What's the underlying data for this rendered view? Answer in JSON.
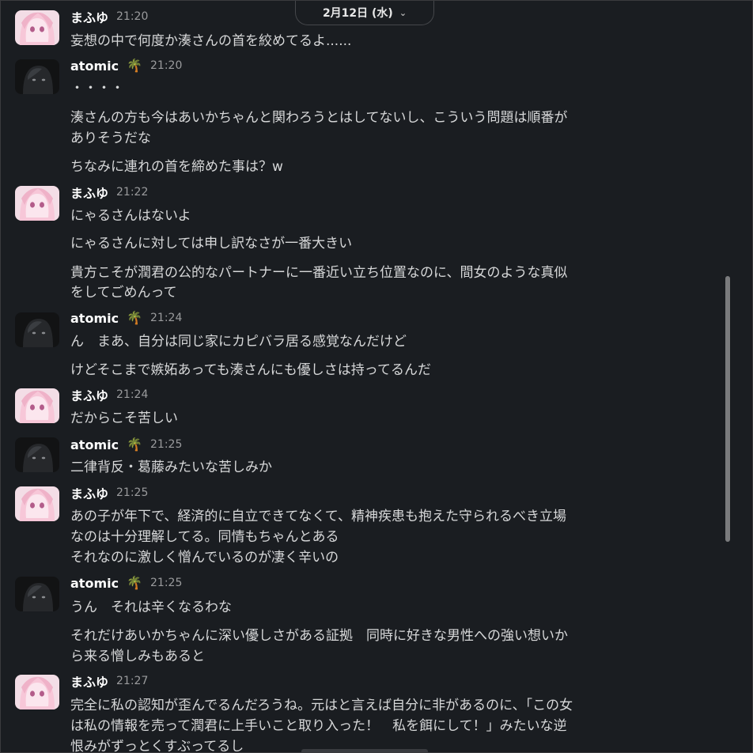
{
  "date_divider": {
    "label": "2月12日 (水)",
    "chevron_icon": "chevron-down-icon"
  },
  "users": {
    "mafuyu": {
      "name": "まふゆ",
      "avatar": "pink-anime-avatar"
    },
    "atomic": {
      "name": "atomic",
      "emoji": "🌴",
      "avatar": "dark-anime-avatar"
    }
  },
  "messages": [
    {
      "author": "まふゆ",
      "time": "21:20",
      "lines": [
        "妄想の中で何度か湊さんの首を絞めてるよ......"
      ]
    },
    {
      "author": "atomic",
      "emoji": "🌴",
      "time": "21:20",
      "lines": [
        "・・・・",
        "湊さんの方も今はあいかちゃんと関わろうとはしてないし、こういう問題は順番が",
        "ありそうだな",
        "ちなみに連れの首を締めた事は？w"
      ]
    },
    {
      "author": "まふゆ",
      "time": "21:22",
      "lines": [
        "にゃるさんはないよ",
        "にゃるさんに対しては申し訳なさが一番大きい",
        "貴方こそが潤君の公的なパートナーに一番近い立ち位置なのに、間女のような真似",
        "をしてごめんって"
      ]
    },
    {
      "author": "atomic",
      "emoji": "🌴",
      "time": "21:24",
      "lines": [
        "ん　まあ、自分は同じ家にカピバラ居る感覚なんだけど",
        "けどそこまで嫉妬あっても湊さんにも優しさは持ってるんだ"
      ]
    },
    {
      "author": "まふゆ",
      "time": "21:24",
      "lines": [
        "だからこそ苦しい"
      ]
    },
    {
      "author": "atomic",
      "emoji": "🌴",
      "time": "21:25",
      "lines": [
        "二律背反・葛藤みたいな苦しみか"
      ]
    },
    {
      "author": "まふゆ",
      "time": "21:25",
      "lines": [
        "あの子が年下で、経済的に自立できてなくて、精神疾患も抱えた守られるべき立場",
        "なのは十分理解してる。同情もちゃんとある",
        "それなのに激しく憎んでいるのが凄く辛いの"
      ]
    },
    {
      "author": "atomic",
      "emoji": "🌴",
      "time": "21:25",
      "lines": [
        "うん　それは辛くなるわな",
        "それだけあいかちゃんに深い優しさがある証拠　同時に好きな男性への強い想いか",
        "ら来る憎しみもあると"
      ]
    },
    {
      "author": "まふゆ",
      "time": "21:27",
      "lines": [
        "完全に私の認知が歪んでるんだろうね。元はと言えば自分に非があるのに、「この女",
        "は私の情報を売って潤君に上手いこと取り入った！　私を餌にして！」みたいな逆",
        "恨みがずっとくすぶってるし"
      ]
    }
  ]
}
